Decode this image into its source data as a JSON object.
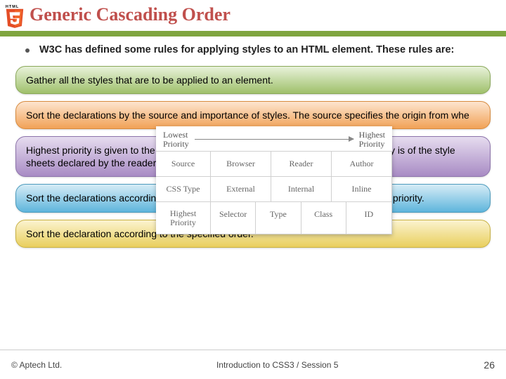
{
  "header": {
    "title": "Generic Cascading Order"
  },
  "bullet": {
    "text": "W3C has defined some rules for applying styles to an HTML element. These rules are:"
  },
  "cards": {
    "c1": "Gather all the styles that are to be applied to an element.",
    "c2": "Sort the declarations by the source and importance of styles. The source specifies the origin from whe",
    "c3": "Highest priority is given to the styles that are declared by the author. The next priority is of the style sheets declared by the reader of the content, and the last priority is of",
    "c4": "Sort the declarations according to the CSS selector. The ID selector has the highest priority.",
    "c5": "Sort the declaration according to the specified order."
  },
  "diagram": {
    "axis_low": "Lowest\nPriority",
    "axis_high": "Highest\nPriority",
    "rows": {
      "r1": {
        "hdr": "Source",
        "a": "Browser",
        "b": "Reader",
        "c": "Author"
      },
      "r2": {
        "hdr": "CSS Type",
        "a": "External",
        "b": "Internal",
        "c": "Inline"
      },
      "r3": {
        "hdr": "Highest\nPriority",
        "a": "Selector",
        "b": "Type",
        "c": "Class",
        "d": "ID"
      }
    }
  },
  "footer": {
    "copyright": "© Aptech Ltd.",
    "mid": "Introduction to CSS3 / Session 5",
    "page": "26"
  }
}
